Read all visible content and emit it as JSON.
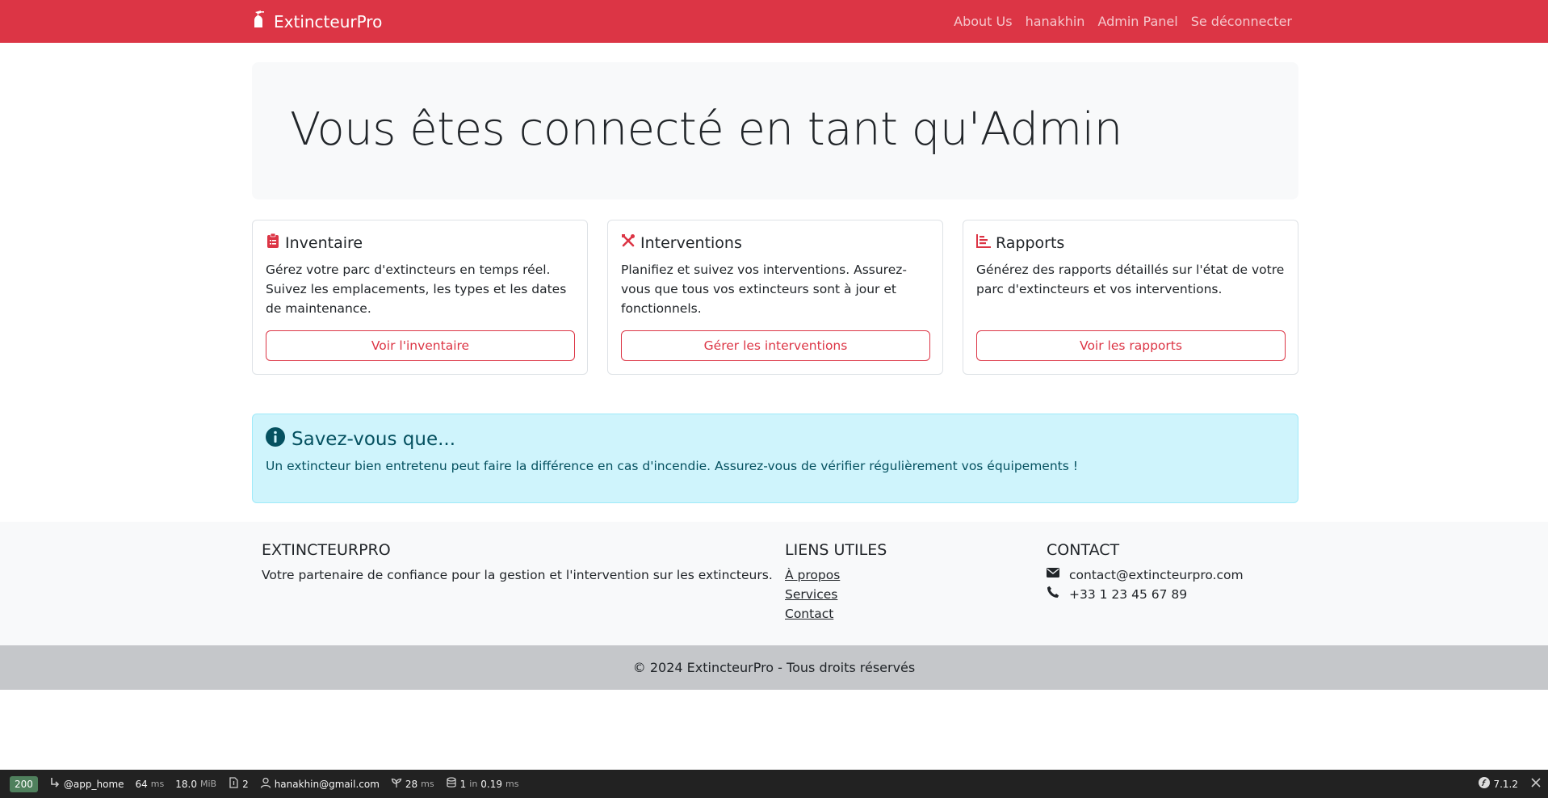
{
  "navbar": {
    "brand": "ExtincteurPro",
    "links": [
      "About Us",
      "hanakhin",
      "Admin Panel",
      "Se déconnecter"
    ]
  },
  "jumbotron": {
    "title": "Vous êtes connecté en tant qu'Admin"
  },
  "cards": [
    {
      "icon": "clipboard-list-icon",
      "title": "Inventaire",
      "text": "Gérez votre parc d'extincteurs en temps réel. Suivez les emplacements, les types et les dates de maintenance.",
      "button": "Voir l'inventaire"
    },
    {
      "icon": "tools-icon",
      "title": "Interventions",
      "text": "Planifiez et suivez vos interventions. Assurez-vous que tous vos extincteurs sont à jour et fonctionnels.",
      "button": "Gérer les interventions"
    },
    {
      "icon": "chart-bar-icon",
      "title": "Rapports",
      "text": "Générez des rapports détaillés sur l'état de votre parc d'extincteurs et vos interventions.",
      "button": "Voir les rapports"
    }
  ],
  "alert": {
    "title": "Savez-vous que...",
    "text": "Un extincteur bien entretenu peut faire la différence en cas d'incendie. Assurez-vous de vérifier régulièrement vos équipements !"
  },
  "footer": {
    "about": {
      "heading": "EXTINCTEURPRO",
      "text": "Votre partenaire de confiance pour la gestion et l'intervention sur les extincteurs."
    },
    "links": {
      "heading": "LIENS UTILES",
      "items": [
        "À propos",
        "Services",
        "Contact"
      ]
    },
    "contact": {
      "heading": "CONTACT",
      "email": "contact@extincteurpro.com",
      "phone": "+33 1 23 45 67 89"
    },
    "copyright": "© 2024 ExtincteurPro - Tous droits réservés"
  },
  "toolbar": {
    "status": "200",
    "route": "@app_home",
    "time_value": "64",
    "time_unit": "ms",
    "memory_value": "18.0",
    "memory_unit": "MiB",
    "forms_count": "2",
    "user": "hanakhin@gmail.com",
    "render_value": "28",
    "render_unit": "ms",
    "db_prefix": "1",
    "db_in": "in",
    "db_value": "0.19",
    "db_unit": "ms",
    "version": "7.1.2"
  },
  "colors": {
    "primary": "#dc3545",
    "alert_bg": "#cff4fc",
    "alert_text": "#055160",
    "footer_bg": "#f8f9fa",
    "copyright_bg": "#c5c7ca",
    "toolbar_bg": "#222222",
    "status_ok": "#4f805d"
  }
}
